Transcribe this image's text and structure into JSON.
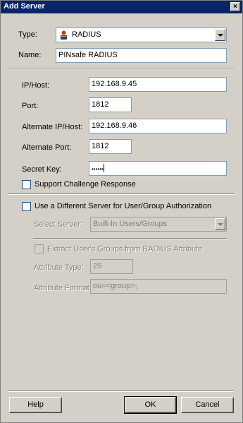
{
  "window": {
    "title": "Add Server",
    "close_glyph": "×"
  },
  "form": {
    "type_label": "Type:",
    "type_value": "RADIUS",
    "name_label": "Name:",
    "name_value": "PINsafe RADIUS",
    "ip_label": "IP/Host:",
    "ip_value": "192.168.9.45",
    "port_label": "Port:",
    "port_value": "1812",
    "alt_ip_label": "Alternate IP/Host:",
    "alt_ip_value": "192.168.9.46",
    "alt_port_label": "Alternate Port:",
    "alt_port_value": "1812",
    "secret_label": "Secret Key:",
    "secret_value": "••••••",
    "challenge_label": "Support Challenge Response",
    "challenge_checked": false,
    "diff_server_label": "Use a Different Server for User/Group Authorization",
    "diff_server_checked": false,
    "select_server_label": "Select Server:",
    "select_server_value": "Built-In Users/Groups",
    "extract_label": "Extract User's Groups from RADIUS Attribute",
    "attr_type_label": "Attribute Type:",
    "attr_type_value": "25",
    "attr_format_label": "Attribute Format:",
    "attr_format_value": "ou=<group>;"
  },
  "buttons": {
    "help": "Help",
    "ok": "OK",
    "cancel": "Cancel"
  },
  "icons": {
    "server_type": "radius-server-icon"
  },
  "colors": {
    "titlebar": "#0a246a",
    "face": "#d4d0c8"
  }
}
